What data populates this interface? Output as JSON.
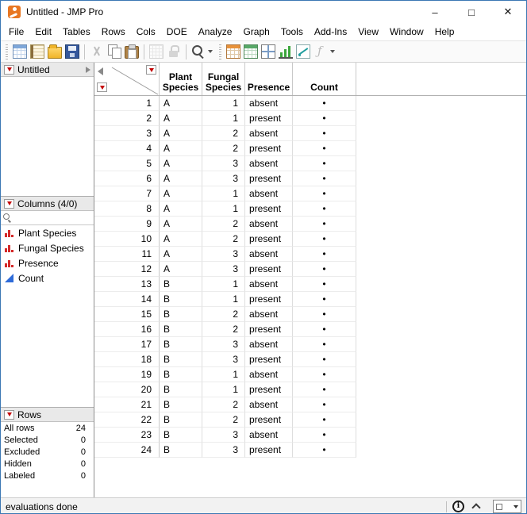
{
  "window": {
    "title": "Untitled - JMP Pro",
    "controls": {
      "minimize": "–",
      "maximize": "□",
      "close": "✕"
    }
  },
  "menu": {
    "items": [
      "File",
      "Edit",
      "Tables",
      "Rows",
      "Cols",
      "DOE",
      "Analyze",
      "Graph",
      "Tools",
      "Add-Ins",
      "View",
      "Window",
      "Help"
    ]
  },
  "toolbar": {
    "groups": [
      {
        "buttons": [
          {
            "name": "new-data-table"
          },
          {
            "name": "new-journal"
          },
          {
            "name": "open-file"
          },
          {
            "name": "save"
          }
        ]
      },
      {
        "buttons": [
          {
            "name": "cut",
            "enabled": false
          },
          {
            "name": "copy"
          },
          {
            "name": "paste"
          }
        ]
      },
      {
        "buttons": [
          {
            "name": "copy-table",
            "enabled": false
          },
          {
            "name": "lock",
            "enabled": false
          }
        ]
      },
      {
        "buttons": [
          {
            "name": "zoom",
            "dropdown": true
          }
        ]
      },
      {
        "buttons": [
          {
            "name": "tabulate"
          },
          {
            "name": "data-table"
          },
          {
            "name": "window-tile"
          },
          {
            "name": "graph-bars"
          },
          {
            "name": "fit-model"
          },
          {
            "name": "formula",
            "enabled": false,
            "dropdown": true
          }
        ]
      }
    ]
  },
  "sidebar": {
    "table_panel": {
      "title": "Untitled"
    },
    "columns_panel": {
      "title": "Columns (4/0)",
      "items": [
        {
          "label": "Plant Species",
          "type": "nominal"
        },
        {
          "label": "Fungal Species",
          "type": "nominal"
        },
        {
          "label": "Presence",
          "type": "nominal"
        },
        {
          "label": "Count",
          "type": "continuous"
        }
      ]
    },
    "rows_panel": {
      "title": "Rows",
      "stats": [
        {
          "label": "All rows",
          "value": "24"
        },
        {
          "label": "Selected",
          "value": "0"
        },
        {
          "label": "Excluded",
          "value": "0"
        },
        {
          "label": "Hidden",
          "value": "0"
        },
        {
          "label": "Labeled",
          "value": "0"
        }
      ]
    }
  },
  "grid": {
    "columns": [
      {
        "key": "plant",
        "label": "Plant\nSpecies"
      },
      {
        "key": "fungal",
        "label": "Fungal\nSpecies"
      },
      {
        "key": "presence",
        "label": "Presence"
      },
      {
        "key": "count",
        "label": "Count"
      }
    ],
    "missing_glyph": "•",
    "rows": [
      [
        "1",
        "A",
        "1",
        "absent",
        "•"
      ],
      [
        "2",
        "A",
        "1",
        "present",
        "•"
      ],
      [
        "3",
        "A",
        "2",
        "absent",
        "•"
      ],
      [
        "4",
        "A",
        "2",
        "present",
        "•"
      ],
      [
        "5",
        "A",
        "3",
        "absent",
        "•"
      ],
      [
        "6",
        "A",
        "3",
        "present",
        "•"
      ],
      [
        "7",
        "A",
        "1",
        "absent",
        "•"
      ],
      [
        "8",
        "A",
        "1",
        "present",
        "•"
      ],
      [
        "9",
        "A",
        "2",
        "absent",
        "•"
      ],
      [
        "10",
        "A",
        "2",
        "present",
        "•"
      ],
      [
        "11",
        "A",
        "3",
        "absent",
        "•"
      ],
      [
        "12",
        "A",
        "3",
        "present",
        "•"
      ],
      [
        "13",
        "B",
        "1",
        "absent",
        "•"
      ],
      [
        "14",
        "B",
        "1",
        "present",
        "•"
      ],
      [
        "15",
        "B",
        "2",
        "absent",
        "•"
      ],
      [
        "16",
        "B",
        "2",
        "present",
        "•"
      ],
      [
        "17",
        "B",
        "3",
        "absent",
        "•"
      ],
      [
        "18",
        "B",
        "3",
        "present",
        "•"
      ],
      [
        "19",
        "B",
        "1",
        "absent",
        "•"
      ],
      [
        "20",
        "B",
        "1",
        "present",
        "•"
      ],
      [
        "21",
        "B",
        "2",
        "absent",
        "•"
      ],
      [
        "22",
        "B",
        "2",
        "present",
        "•"
      ],
      [
        "23",
        "B",
        "3",
        "absent",
        "•"
      ],
      [
        "24",
        "B",
        "3",
        "present",
        "•"
      ]
    ]
  },
  "statusbar": {
    "message": "evaluations done",
    "info_glyph": "i"
  }
}
